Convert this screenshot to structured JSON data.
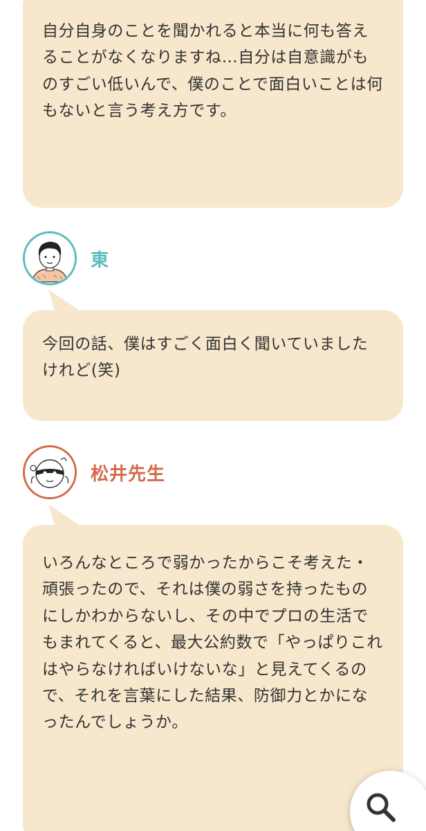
{
  "colors": {
    "bubble_bg": "#f7e7cc",
    "azuma_accent": "#5bbcc0",
    "matsui_accent": "#d4694a"
  },
  "messages": [
    {
      "text": "自分自身のことを聞かれると本当に何も答えることがなくなりますね…自分は自意識がものすごい低いんで、僕のことで面白いことは何もないと言う考え方です。"
    },
    {
      "speaker": "東",
      "avatar_icon": "person-avatar-icon",
      "text": "今回の話、僕はすごく面白く聞いていましたけれど(笑)"
    },
    {
      "speaker": "松井先生",
      "avatar_icon": "character-avatar-icon",
      "text": "いろんなところで弱かったからこそ考えた・頑張ったので、それは僕の弱さを持ったものにしかわからないし、その中でプロの生活でもまれてくると、最大公約数で「やっぱりこれはやらなければいけないな」と見えてくるので、それを言葉にした結果、防御力とかになったんでしょうか。"
    }
  ],
  "search_button": {
    "icon": "search-icon"
  }
}
